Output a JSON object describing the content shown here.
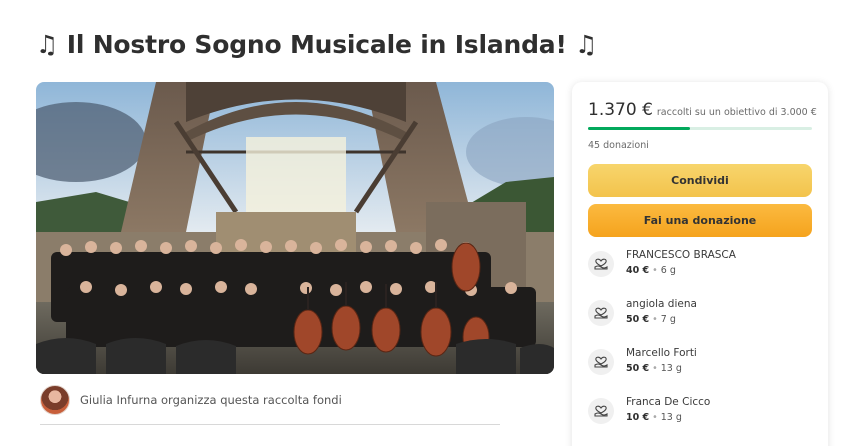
{
  "campaign": {
    "title": "♫ Il Nostro Sogno Musicale in Islanda! ♫",
    "organizer_text": "Giulia Infurna organizza questa raccolta fondi"
  },
  "donation_card": {
    "raised_amount": "1.370 €",
    "raised_text": "raccolti su un obiettivo di 3.000 €",
    "progress_fraction": 0.457,
    "donation_count": "45 donazioni",
    "share_label": "Condividi",
    "donate_label": "Fai una donazione",
    "progress_color": "#02a95c",
    "share_color": "#f5cc5a",
    "donate_color": "#f8ae2e"
  },
  "donors": [
    {
      "name": "FRANCESCO BRASCA",
      "amount": "40 €",
      "time": "6 g"
    },
    {
      "name": "angiola diena",
      "amount": "50 €",
      "time": "7 g"
    },
    {
      "name": "Marcello Forti",
      "amount": "50 €",
      "time": "13 g"
    },
    {
      "name": "Franca De Cicco",
      "amount": "10 €",
      "time": "13 g"
    }
  ],
  "icons": {
    "donor": "heart-hand-icon",
    "avatar": "organizer-avatar"
  }
}
